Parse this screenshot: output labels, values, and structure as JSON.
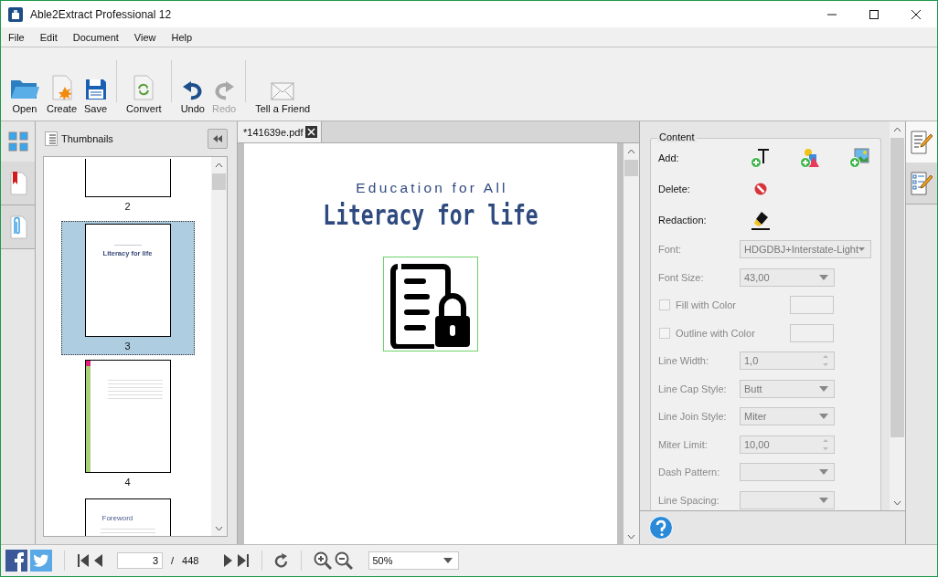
{
  "window": {
    "title": "Able2Extract Professional 12"
  },
  "menu": [
    {
      "label": "File"
    },
    {
      "label": "Edit"
    },
    {
      "label": "Document"
    },
    {
      "label": "View"
    },
    {
      "label": "Help"
    }
  ],
  "toolbar": [
    [
      {
        "label": "Open",
        "kind": "open",
        "disabled": false
      },
      {
        "label": "Create",
        "kind": "create",
        "disabled": false
      },
      {
        "label": "Save",
        "kind": "save",
        "disabled": false
      }
    ],
    [
      {
        "label": "Convert",
        "kind": "convert",
        "disabled": false
      }
    ],
    [
      {
        "label": "Undo",
        "kind": "undo",
        "disabled": false
      },
      {
        "label": "Redo",
        "kind": "redo",
        "disabled": true
      }
    ],
    [
      {
        "label": "Tell a Friend",
        "kind": "mail",
        "disabled": false
      }
    ]
  ],
  "left_tabs": [
    {
      "kind": "thumbnails",
      "selected": true
    },
    {
      "kind": "bookmarks",
      "selected": false
    },
    {
      "kind": "attachments",
      "selected": false
    }
  ],
  "thumbnails": {
    "title": "Thumbnails",
    "pages": [
      {
        "kind": "blank",
        "label": "2",
        "selected": false
      },
      {
        "kind": "cover",
        "label": "3",
        "selected": true,
        "title": "Literacy for life"
      },
      {
        "kind": "text",
        "label": "4",
        "selected": false
      },
      {
        "kind": "foreword",
        "selected": false,
        "title": "Foreword"
      }
    ]
  },
  "document": {
    "tab": {
      "label": "*141639e.pdf"
    },
    "page": {
      "subtitle": "Education for All",
      "title": "Literacy for life",
      "image_selected": true
    }
  },
  "content_panel": {
    "title": "Content",
    "actions": [
      {
        "label": "Add:",
        "tools": [
          {
            "kind": "add-text"
          },
          {
            "kind": "add-shape"
          },
          {
            "kind": "add-image"
          }
        ]
      },
      {
        "label": "Delete:",
        "tools": [
          {
            "kind": "delete"
          }
        ]
      },
      {
        "label": "Redaction:",
        "tools": [
          {
            "kind": "redact"
          }
        ]
      }
    ],
    "properties": [
      {
        "kind": "dropdown",
        "label": "Font:",
        "value": "HDGDBJ+Interstate-Light",
        "wide": true,
        "disabled": true
      },
      {
        "kind": "dropdown",
        "label": "Font Size:",
        "value": "43,00",
        "disabled": true
      },
      {
        "kind": "color-check",
        "label": "Fill with Color",
        "checked": false,
        "disabled": true
      },
      {
        "kind": "color-check",
        "label": "Outline with Color",
        "checked": false,
        "disabled": true
      },
      {
        "kind": "spin",
        "label": "Line Width:",
        "value": "1,0",
        "disabled": true
      },
      {
        "kind": "dropdown",
        "label": "Line Cap Style:",
        "value": "Butt",
        "disabled": true
      },
      {
        "kind": "dropdown",
        "label": "Line Join Style:",
        "value": "Miter",
        "disabled": true
      },
      {
        "kind": "spin",
        "label": "Miter Limit:",
        "value": "10,00",
        "disabled": true
      },
      {
        "kind": "dropdown",
        "label": "Dash Pattern:",
        "disabled": true
      },
      {
        "kind": "dropdown",
        "label": "Line Spacing:",
        "disabled": true
      }
    ]
  },
  "right_tabs": [
    {
      "kind": "edit-text",
      "selected": true
    },
    {
      "kind": "edit-form",
      "selected": false
    }
  ],
  "status_bar": {
    "page": "3",
    "separator": "/",
    "total": "448",
    "zoom": "50%"
  }
}
